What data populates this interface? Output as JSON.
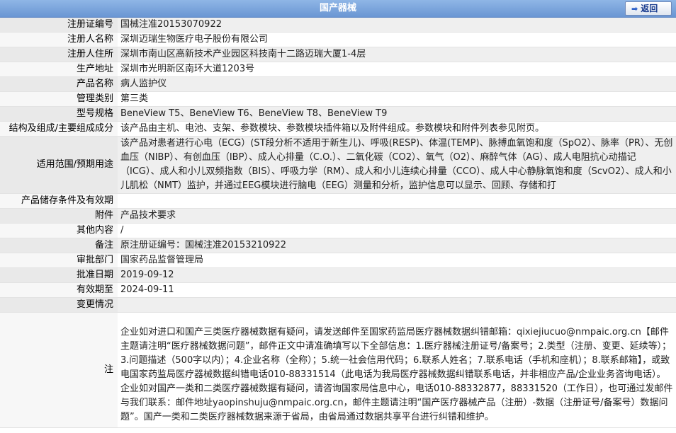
{
  "header": {
    "title": "国产器械",
    "back_label": "返回"
  },
  "rows": {
    "reg_no": {
      "label": "注册证编号",
      "value": "国械注准20153070922"
    },
    "registrant": {
      "label": "注册人名称",
      "value": "深圳迈瑞生物医疗电子股份有限公司"
    },
    "address": {
      "label": "注册人住所",
      "value": "深圳市南山区高新技术产业园区科技南十二路迈瑞大厦1-4层"
    },
    "production": {
      "label": "生产地址",
      "value": "深圳市光明新区南环大道1203号"
    },
    "product_name": {
      "label": "产品名称",
      "value": "病人监护仪"
    },
    "category": {
      "label": "管理类别",
      "value": "第三类"
    },
    "model": {
      "label": "型号规格",
      "value": "BeneView T5、BeneView T6、BeneView T8、BeneView T9"
    },
    "structure": {
      "label": "结构及组成/主要组成成分",
      "value": "该产品由主机、电池、支架、参数模块、参数模块插件箱以及附件组成。参数模块和附件列表参见附页。"
    },
    "scope": {
      "label": "适用范围/预期用途",
      "value": "该产品对患者进行心电（ECG）(ST段分析不适用于新生儿)、呼吸(RESP)、体温(TEMP)、脉搏血氧饱和度（SpO2）、脉率（PR）、无创血压（NIBP）、有创血压（IBP）、成人心排量（C.O.）、二氧化碳（CO2）、氧气（O2）、麻醉气体（AG）、成人电阻抗心动描记（ICG）、成人和小儿双频指数（BIS）、呼吸力学（RM）、成人和小儿连续心排量（CCO）、成人中心静脉氧饱和度（ScvO2）、成人和小儿肌松（NMT）监护，并通过EEG模块进行脑电（EEG）测量和分析，监护信息可以显示、回顾、存储和打"
    },
    "storage": {
      "label": "产品储存条件及有效期",
      "value": ""
    },
    "attachment": {
      "label": "附件",
      "value": "产品技术要求"
    },
    "other": {
      "label": "其他内容",
      "value": "/"
    },
    "remark": {
      "label": "备注",
      "value": "原注册证编号：国械注准20153210922"
    },
    "dept": {
      "label": "审批部门",
      "value": "国家药品监督管理局"
    },
    "approve_date": {
      "label": "批准日期",
      "value": "2019-09-12"
    },
    "expire_date": {
      "label": "有效期至",
      "value": "2024-09-11"
    },
    "changes": {
      "label": "变更情况",
      "value": ""
    },
    "note": {
      "label": "注",
      "value": "企业如对进口和国产三类医疗器械数据有疑问，请发送邮件至国家药监局医疗器械数据纠错邮箱：qixiejiucuo@nmpaic.org.cn【邮件主题请注明“医疗器械数据问题”，邮件正文中请准确填写以下全部信息：1.医疗器械注册证号/备案号；2.类型（注册、变更、延续等）；3.问题描述（500字以内）；4.企业名称（全称）；5.统一社会信用代码；6.联系人姓名；7.联系电话（手机和座机）；8.联系邮箱】，或致电国家药监局医疗器械数据纠错电话010-88331514（此电话为我局医疗器械数据纠错联系电话，并非相应产品/企业业务咨询电话）。企业如对国产一类和二类医疗器械数据有疑问，请咨询国家局信息中心，电话010-88332877，88331520（工作日），也可通过发邮件与我们联系：邮件地址yaopinshuju@nmpaic.org.cn，邮件主题请注明“国产医疗器械产品（注册）-数据（注册证号/备案号）数据问题”。国产一类和二类医疗器械数据来源于省局，由省局通过数据共享平台进行纠错和维护。"
    }
  }
}
